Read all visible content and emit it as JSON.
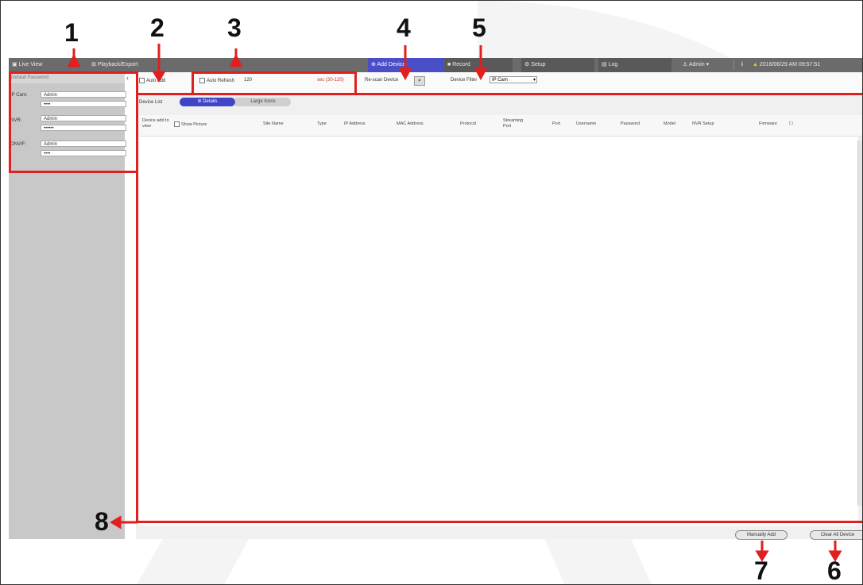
{
  "topbar": {
    "tabs": [
      {
        "label": "Live View"
      },
      {
        "label": "Playback/Export"
      },
      {
        "label": "Add Device"
      },
      {
        "label": "Record"
      },
      {
        "label": "Setup"
      },
      {
        "label": "Log"
      }
    ],
    "user": "Admin",
    "info": "i",
    "datetime": "2016/06/29 AM 09:57:51"
  },
  "left_panel": {
    "header": "Default Password",
    "rows": [
      {
        "label": "IP Cam:",
        "user": "Admin",
        "password": "••••"
      },
      {
        "label": "NVR:",
        "user": "Admin",
        "password": "••••••"
      },
      {
        "label": "ONVIF:",
        "user": "Admin",
        "password": "••••"
      }
    ]
  },
  "toolbar": {
    "auto_add": "Auto Add",
    "auto_refresh": "Auto Refresh",
    "refresh_value": "120",
    "refresh_unit": "sec (30-120)",
    "rescan": "Re-scan Device",
    "device_filter": "Device Filter",
    "device_filter_value": "IP Cam"
  },
  "device_list": {
    "label": "Device List",
    "tab_details": "Details",
    "tab_large_icons": "Large Icons",
    "columns": [
      "Device add to view",
      "Show Picture",
      "Site Name",
      "Type",
      "IP Address",
      "MAC Address",
      "Protocol",
      "Streaming Port",
      "Port",
      "Username",
      "Password",
      "Model",
      "NVR Setup",
      "Firmware"
    ]
  },
  "buttons": {
    "manually_add": "Manually Add",
    "clear_all": "Clear All Device"
  },
  "callouts": [
    "1",
    "2",
    "3",
    "4",
    "5",
    "6",
    "7",
    "8"
  ],
  "colors": {
    "callout": "#e11f1f",
    "accent": "#3f45c4"
  }
}
